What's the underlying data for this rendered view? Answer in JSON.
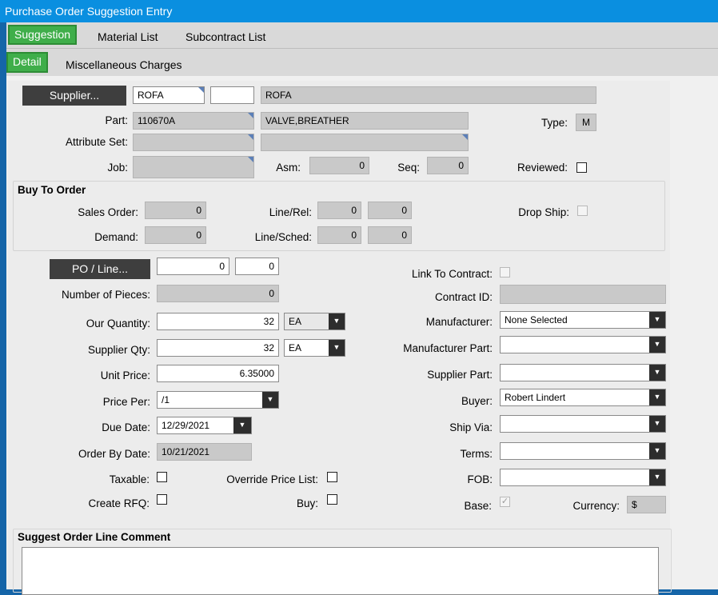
{
  "window": {
    "title": "Purchase Order Suggestion Entry"
  },
  "tabs_main": [
    {
      "label": "Suggestion"
    },
    {
      "label": "Material List"
    },
    {
      "label": "Subcontract List"
    }
  ],
  "tabs_sub": [
    {
      "label": "Detail"
    },
    {
      "label": "Miscellaneous Charges"
    }
  ],
  "header": {
    "supplier_button": "Supplier...",
    "supplier_id": "ROFA",
    "supplier_extra": "",
    "supplier_name": "ROFA",
    "part_label": "Part:",
    "part_value": "110670A",
    "part_desc": "VALVE,BREATHER",
    "type_label": "Type:",
    "type_value": "M",
    "attribute_label": "Attribute Set:",
    "attribute_value": "",
    "attribute_desc": "",
    "job_label": "Job:",
    "job_value": "",
    "asm_label": "Asm:",
    "asm_value": "0",
    "seq_label": "Seq:",
    "seq_value": "0",
    "reviewed_label": "Reviewed:"
  },
  "buy_to_order": {
    "title": "Buy To Order",
    "sales_order_label": "Sales Order:",
    "sales_order_value": "0",
    "line_rel_label": "Line/Rel:",
    "line_value": "0",
    "rel_value": "0",
    "drop_ship_label": "Drop Ship:",
    "demand_label": "Demand:",
    "demand_value": "0",
    "line_sched_label": "Line/Sched:",
    "sched_line_value": "0",
    "sched_value": "0"
  },
  "left": {
    "po_line_button": "PO / Line...",
    "po_value": "0",
    "line_value": "0",
    "pieces_label": "Number of Pieces:",
    "pieces_value": "0",
    "our_qty_label": "Our Quantity:",
    "our_qty_value": "32",
    "our_qty_uom": "EA",
    "supplier_qty_label": "Supplier Qty:",
    "supplier_qty_value": "32",
    "supplier_qty_uom": "EA",
    "unit_price_label": "Unit Price:",
    "unit_price_value": "6.35000",
    "price_per_label": "Price Per:",
    "price_per_value": "/1",
    "due_date_label": "Due Date:",
    "due_date_value": "12/29/2021",
    "order_by_label": "Order By Date:",
    "order_by_value": "10/21/2021",
    "taxable_label": "Taxable:",
    "override_label": "Override Price List:",
    "create_rfq_label": "Create RFQ:",
    "buy_label": "Buy:"
  },
  "right": {
    "link_contract_label": "Link To Contract:",
    "contract_id_label": "Contract ID:",
    "contract_id_value": "",
    "manufacturer_label": "Manufacturer:",
    "manufacturer_value": "None Selected",
    "manufacturer_part_label": "Manufacturer Part:",
    "manufacturer_part_value": "",
    "supplier_part_label": "Supplier Part:",
    "supplier_part_value": "",
    "buyer_label": "Buyer:",
    "buyer_value": "Robert Lindert",
    "ship_via_label": "Ship Via:",
    "ship_via_value": "",
    "terms_label": "Terms:",
    "terms_value": "",
    "fob_label": "FOB:",
    "fob_value": "",
    "base_label": "Base:",
    "currency_label": "Currency:",
    "currency_value": "$"
  },
  "comment": {
    "title": "Suggest Order Line Comment",
    "value": ""
  },
  "icons": {
    "dropdown": "chevron-down-icon",
    "check": "check-icon"
  },
  "colors": {
    "titlebar": "#0a8fe0",
    "active_tab": "#3fae4a",
    "button": "#3e3e3e"
  }
}
